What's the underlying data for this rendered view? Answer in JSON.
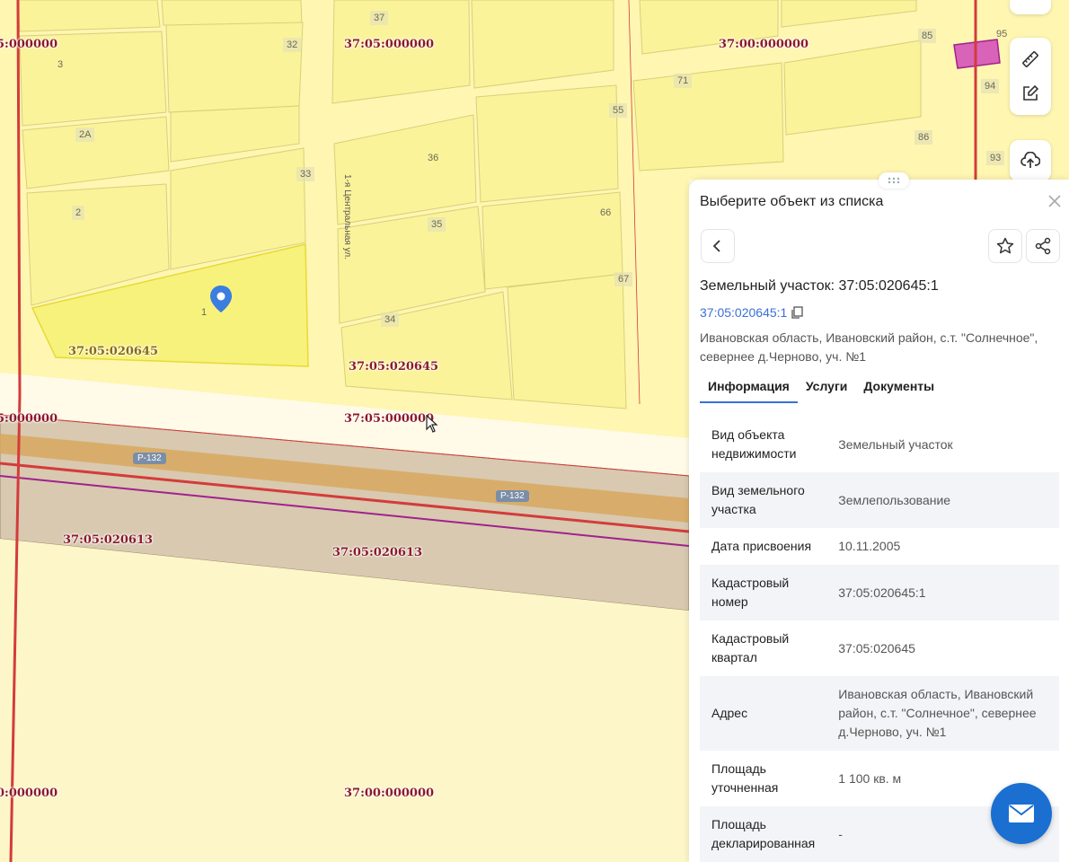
{
  "map": {
    "quarter_labels": [
      {
        "text": "5:000000",
        "variant": "red"
      },
      {
        "text": "37:05:000000",
        "variant": "red"
      },
      {
        "text": "37:00:000000",
        "variant": "red"
      },
      {
        "text": "37:05:020645",
        "variant": "gold"
      },
      {
        "text": "37:05:020645",
        "variant": "red"
      },
      {
        "text": "5:000000",
        "variant": "red"
      },
      {
        "text": "37:05:000000",
        "variant": "red"
      },
      {
        "text": "37:05:020613",
        "variant": "red"
      },
      {
        "text": "37:05:020613",
        "variant": "red"
      },
      {
        "text": "0:000000",
        "variant": "red"
      },
      {
        "text": "37:00:000000",
        "variant": "red"
      }
    ],
    "house_numbers": [
      "37",
      "32",
      "3",
      "2А",
      "33",
      "2",
      "1",
      "36",
      "35",
      "34",
      "55",
      "71",
      "66",
      "67",
      "85",
      "95",
      "94",
      "86",
      "93"
    ],
    "road_badges": [
      "Р-132",
      "Р-132"
    ],
    "street_name": "1-я Центральная ул.",
    "colors": {
      "parcel_fill": "#fdf38a",
      "selected_fill": "#f7f27a",
      "road_fill": "#d8c9b0",
      "road_center": "#d8a65a",
      "boundary_red": "#d43b3b",
      "magenta": "#a0228c",
      "pin": "#3b7de0"
    }
  },
  "tools": {
    "ruler_icon": "ruler-icon",
    "edit_icon": "edit-icon",
    "upload_icon": "upload-cloud-icon"
  },
  "panel": {
    "title": "Выберите объект из списка",
    "object_title": "Земельный участок: 37:05:020645:1",
    "cadastral_link": "37:05:020645:1",
    "address": "Ивановская область, Ивановский район, с.т. \"Солнечное\", севернее д.Черново, уч. №1",
    "tabs": [
      "Информация",
      "Услуги",
      "Документы"
    ],
    "active_tab": "Информация",
    "rows": [
      {
        "key": "Вид объекта недвижимости",
        "value": "Земельный участок"
      },
      {
        "key": "Вид земельного участка",
        "value": "Землепользование"
      },
      {
        "key": "Дата присвоения",
        "value": "10.11.2005"
      },
      {
        "key": "Кадастровый номер",
        "value": "37:05:020645:1"
      },
      {
        "key": "Кадастровый квартал",
        "value": "37:05:020645"
      },
      {
        "key": "Адрес",
        "value": "Ивановская область, Ивановский район, с.т. \"Солнечное\", севернее д.Черново, уч. №1"
      },
      {
        "key": "Площадь уточненная",
        "value": "1 100 кв. м"
      },
      {
        "key": "Площадь декларированная",
        "value": "-"
      }
    ]
  }
}
